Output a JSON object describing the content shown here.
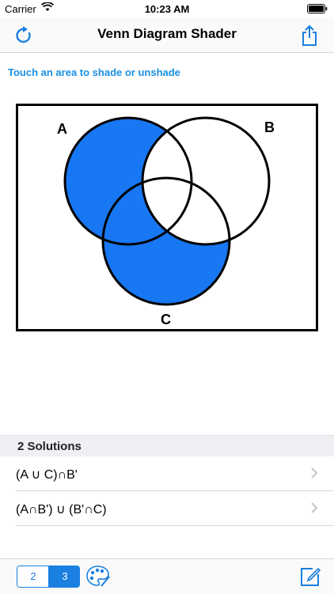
{
  "status_bar": {
    "carrier": "Carrier",
    "time": "10:23 AM"
  },
  "nav": {
    "title": "Venn Diagram Shader",
    "left_icon": "refresh-icon",
    "right_icon": "share-icon"
  },
  "instruction": "Touch an area to shade or unshade",
  "venn": {
    "labels": {
      "a": "A",
      "b": "B",
      "c": "C"
    },
    "shade_color": "#1877f2",
    "shaded_regions": [
      "A only",
      "A∩C only",
      "C only"
    ]
  },
  "solutions": {
    "header": "2 Solutions",
    "items": [
      "(A ∪ C)∩B'",
      "(A∩B') ∪ (B'∩C)"
    ]
  },
  "toolbar": {
    "segments": [
      "2",
      "3"
    ],
    "selected_segment": "3",
    "palette_icon": "palette-icon",
    "edit_icon": "edit-icon"
  },
  "colors": {
    "accent": "#1a7fe0",
    "instruction": "#1a8fe3"
  }
}
